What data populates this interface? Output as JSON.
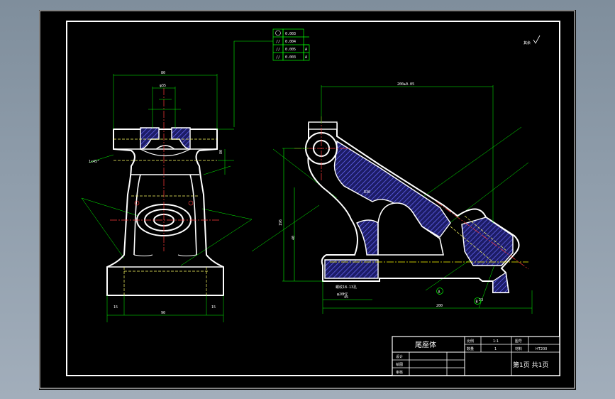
{
  "colors": {
    "background": "#000000",
    "frame": "#ffffff",
    "dimension": "#00ff00",
    "centerline": "#ff3b3b",
    "hatch": "#5a5aff",
    "axis": "#ffff00",
    "hidden": "#ffff66"
  },
  "annotations": {
    "roughness_symbol": "其余",
    "tolerance_rows": [
      "0.003",
      "0.004",
      "0.005",
      "0.003"
    ],
    "tolerance_datum": [
      "",
      "",
      "A",
      "A"
    ],
    "dim_top_width": "80",
    "dim_slot": "φ35",
    "dim_bottom_width": "90",
    "dim_left_15": "15",
    "dim_right_15": "15",
    "dim_hole_depth": "80",
    "dim_chamfer": "1x45°",
    "dim_side_top": "200±0.05",
    "dim_side_base": "200",
    "dim_side_height": "196",
    "dim_side_45": "45",
    "dim_note": "螺纹18-13孔",
    "dim_note2": "φ20H7",
    "datum_a": "A",
    "datum_b": "B",
    "dim_r30": "R30",
    "dim_40": "40",
    "dim_23": "23"
  },
  "title_block": {
    "part_name": "尾座体",
    "label_scale": "比例",
    "scale_value": "1:1",
    "label_drawing_no": "图号",
    "label_quantity": "数量",
    "quantity_value": "1",
    "label_material": "材料",
    "material_value": "HT200",
    "label_design": "设计",
    "label_draw": "绘图",
    "label_review": "审核",
    "sheet_text": "第1页  共1页"
  }
}
